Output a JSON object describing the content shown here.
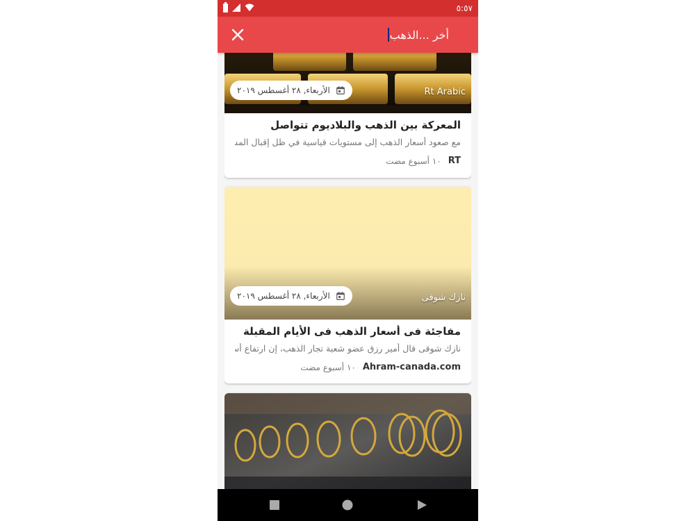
{
  "status_bar": {
    "time": "٥:٥٧"
  },
  "app_bar": {
    "search_query": "الذهب",
    "search_placeholder": "أخر ..."
  },
  "articles": [
    {
      "image_source": "Rt Arabic",
      "date": "الأربعاء, ٢٨ أغسطس ٢٠١٩",
      "headline": "المعركة بين الذهب والبلاديوم تتواصل",
      "snippet": "مع صعود أسعار الذهب إلى مستويات قياسية في ظل إقبال المستثمري..",
      "source": "RT",
      "age": "١٠ أسبوع مضت"
    },
    {
      "image_source": "نازك شوقى",
      "date": "الأربعاء, ٢٨ أغسطس ٢٠١٩",
      "headline": "مفاجئة فى أسعار الذهب فى الأيام المقبلة",
      "snippet": "نازك شوقى قال أمير رزق عضو شعبة تجار الذهب، إن ارتفاع أسعار ال...",
      "source": "Ahram-canada.com",
      "age": "١٠ أسبوع مضت"
    }
  ],
  "colors": {
    "status_bar": "#d32f2f",
    "app_bar": "#e8484a",
    "placeholder_image": "#fdeeb0"
  }
}
